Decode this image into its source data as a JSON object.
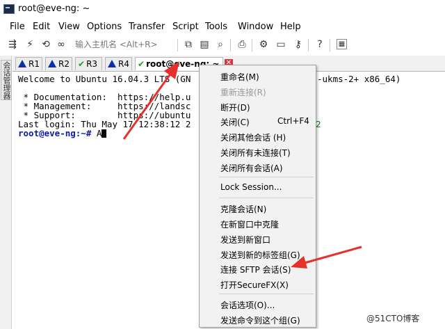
{
  "window": {
    "title": "root@eve-ng: ~"
  },
  "menubar": [
    "File",
    "Edit",
    "View",
    "Options",
    "Transfer",
    "Script",
    "Tools",
    "Window",
    "Help"
  ],
  "toolbar": {
    "host_placeholder": "输入主机名 <Alt+R>"
  },
  "sidebar": {
    "session_manager_label": "会话管理器"
  },
  "tabs": [
    {
      "label": "R1",
      "status": "warning"
    },
    {
      "label": "R2",
      "status": "warning"
    },
    {
      "label": "R3",
      "status": "connected"
    },
    {
      "label": "R4",
      "status": "warning"
    },
    {
      "label": "root@eve-ng: ~",
      "status": "connected",
      "active": true
    }
  ],
  "terminal": {
    "lines": [
      "Welcome to Ubuntu 16.04.3 LTS (GN",
      " * Documentation:  https://help.u",
      " * Management:     https://landsc",
      " * Support:        https://ubuntu",
      "Last login: Thu May 17 12:38:12 2"
    ],
    "right_fragment_1": "-ukms-2+ x86_64)",
    "right_fragment_2": "2",
    "prompt": "root@eve-ng:~#",
    "input": " A"
  },
  "context_menu": {
    "items": [
      {
        "label": "重命名(M)",
        "disabled": false
      },
      {
        "label": "重新连接(R)",
        "disabled": true
      },
      {
        "label": "断开(D)",
        "disabled": false
      },
      {
        "label": "关闭(C)",
        "shortcut": "Ctrl+F4",
        "disabled": false
      },
      {
        "label": "关闭其他会话 (H)",
        "disabled": false
      },
      {
        "label": "关闭所有未连接(T)",
        "disabled": false
      },
      {
        "label": "关闭所有会话(A)",
        "disabled": false
      },
      {
        "label": "Lock Session...",
        "disabled": false
      },
      {
        "label": "克隆会话(N)",
        "disabled": false
      },
      {
        "label": "在新窗口中克隆",
        "disabled": false
      },
      {
        "label": "发送到新窗口",
        "disabled": false
      },
      {
        "label": "发送到新的标签组(G)",
        "disabled": false
      },
      {
        "label": "连接 SFTP 会话(S)",
        "disabled": false
      },
      {
        "label": "打开SecureFX(X)",
        "disabled": false
      },
      {
        "label": "会话选项(O)...",
        "disabled": false
      },
      {
        "label": "发送命令到这个组(G)",
        "disabled": false
      }
    ]
  },
  "watermark": "@51CTO博客",
  "colors": {
    "prompt": "#0a1aa8",
    "arrow": "#e8302a",
    "check": "#1aa31a"
  }
}
